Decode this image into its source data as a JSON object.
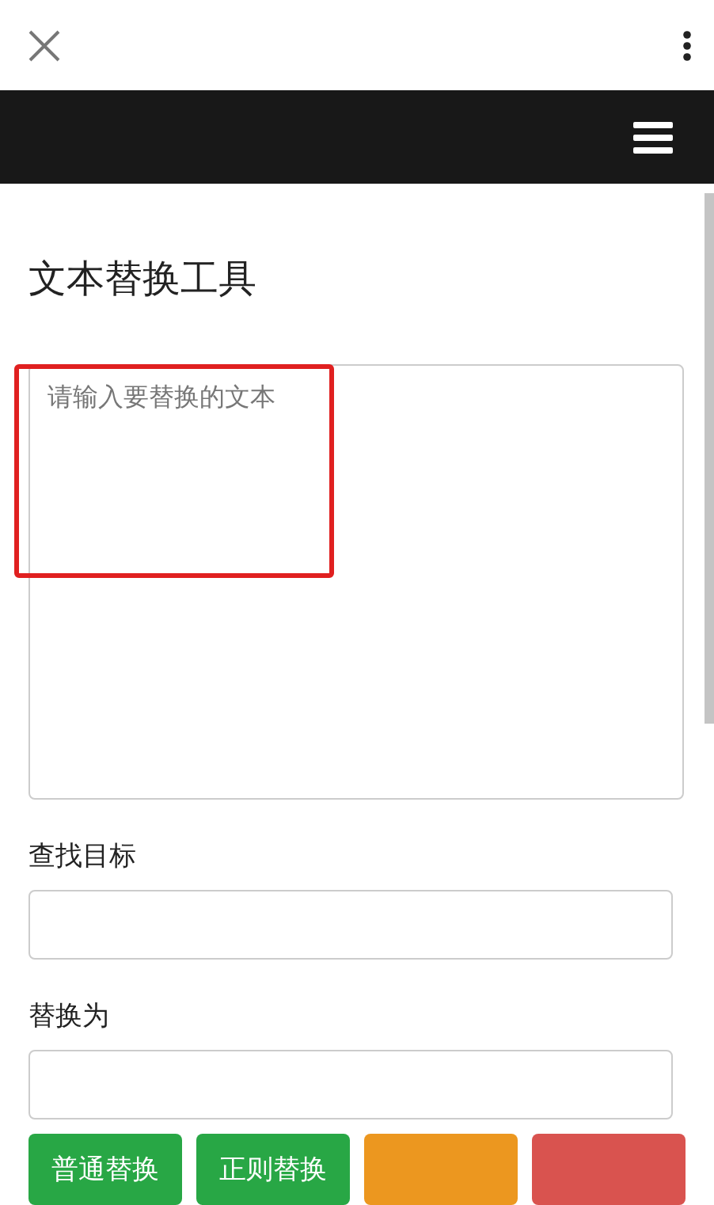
{
  "page": {
    "title": "文本替换工具"
  },
  "source_text": {
    "placeholder": "请输入要替换的文本",
    "highlighted": true
  },
  "fields": [
    {
      "label": "查找目标"
    },
    {
      "label": "替换为"
    }
  ],
  "buttons": [
    {
      "label": "普通替换",
      "kind": "success"
    },
    {
      "label": "正则替换",
      "kind": "success"
    },
    {
      "kind": "warning"
    },
    {
      "kind": "danger"
    }
  ]
}
